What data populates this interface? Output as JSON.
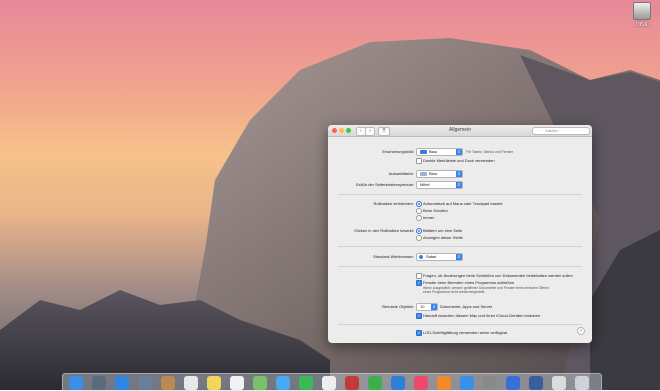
{
  "desktop": {
    "disk_label": "DISK"
  },
  "window": {
    "title": "Allgemein",
    "nav": {
      "back": "‹",
      "forward": "›",
      "grid": "⠿"
    },
    "search_placeholder": "Suchen",
    "appearance": {
      "label": "Erscheinungsbild:",
      "value": "Blau",
      "hint": "Für Tasten, Menüs und Fenster",
      "dark_mode_label": "Dunkle Menüleiste und Dock verwenden",
      "dark_mode_checked": false
    },
    "highlight": {
      "label": "Auswahlfarbe:",
      "value": "Blau"
    },
    "sidebar_size": {
      "label": "Größe der Seitenleistensymbole:",
      "value": "Mittel"
    },
    "scrollbars": {
      "label": "Rollbalken einblenden:",
      "options": [
        "Automatisch auf Maus oder Trackpad basiert",
        "Beim Scrollen",
        "Immer"
      ],
      "selected": 0
    },
    "click_scrollbar": {
      "label": "Klicken in den Rollbalken bewirkt:",
      "options": [
        "Blättern um eine Seite",
        "Anzeigen dieser Stelle"
      ],
      "selected": 0
    },
    "browser": {
      "label": "Standard-Webbrowser:",
      "value": "Safari"
    },
    "ask_keep_changes": {
      "label": "Fragen, ob Änderungen beim Schließen von Dokumenten beibehalten werden sollen",
      "checked": false
    },
    "close_windows": {
      "label": "Fenster beim Beenden eines Programms schließen",
      "checked": true,
      "note_line1": "Wenn ausgewählt, werden geöffnete Dokumente und Fenster beim erneuten Öffnen",
      "note_line2": "eines Programms nicht wiederhergestellt."
    },
    "recent_items": {
      "label": "Benutzte Objekte:",
      "value": "10",
      "suffix": "Dokumente, Apps und Server"
    },
    "handoff": {
      "label": "Handoff zwischen diesem Mac und Ihren iCloud-Geräten erlauben",
      "checked": true
    },
    "lcd_smoothing": {
      "label": "LCD-Schriftglättung verwenden wenn verfügbar",
      "checked": true
    },
    "help": "?"
  },
  "dock": {
    "items": [
      {
        "name": "finder",
        "color": "#3c8fe6"
      },
      {
        "name": "launchpad",
        "color": "#5a6b7c"
      },
      {
        "name": "safari",
        "color": "#2f86e0"
      },
      {
        "name": "photo",
        "color": "#6b7f99"
      },
      {
        "name": "contacts",
        "color": "#b98b52"
      },
      {
        "name": "calendar",
        "color": "#e8e8e8"
      },
      {
        "name": "notes",
        "color": "#f2d55a"
      },
      {
        "name": "reminders",
        "color": "#f2f2f2"
      },
      {
        "name": "maps",
        "color": "#7bbf6a"
      },
      {
        "name": "messages",
        "color": "#4aa8f0"
      },
      {
        "name": "facetime",
        "color": "#3cb957"
      },
      {
        "name": "photos",
        "color": "#eeeeee"
      },
      {
        "name": "photobooth",
        "color": "#c43a3a"
      },
      {
        "name": "numbers",
        "color": "#3fae4f"
      },
      {
        "name": "keynote",
        "color": "#2f7ed8"
      },
      {
        "name": "itunes",
        "color": "#ee4a6b"
      },
      {
        "name": "ibooks",
        "color": "#f08a2b"
      },
      {
        "name": "appstore",
        "color": "#3a8fe8"
      },
      {
        "name": "system-preferences",
        "color": "#8a8a8a"
      },
      {
        "name": "network",
        "color": "#3a6fd8"
      },
      {
        "name": "finder-folder",
        "color": "#3a5f9a"
      },
      {
        "name": "downloads",
        "color": "#dcdcdc"
      },
      {
        "name": "trash",
        "color": "#cfd3d8"
      }
    ]
  }
}
